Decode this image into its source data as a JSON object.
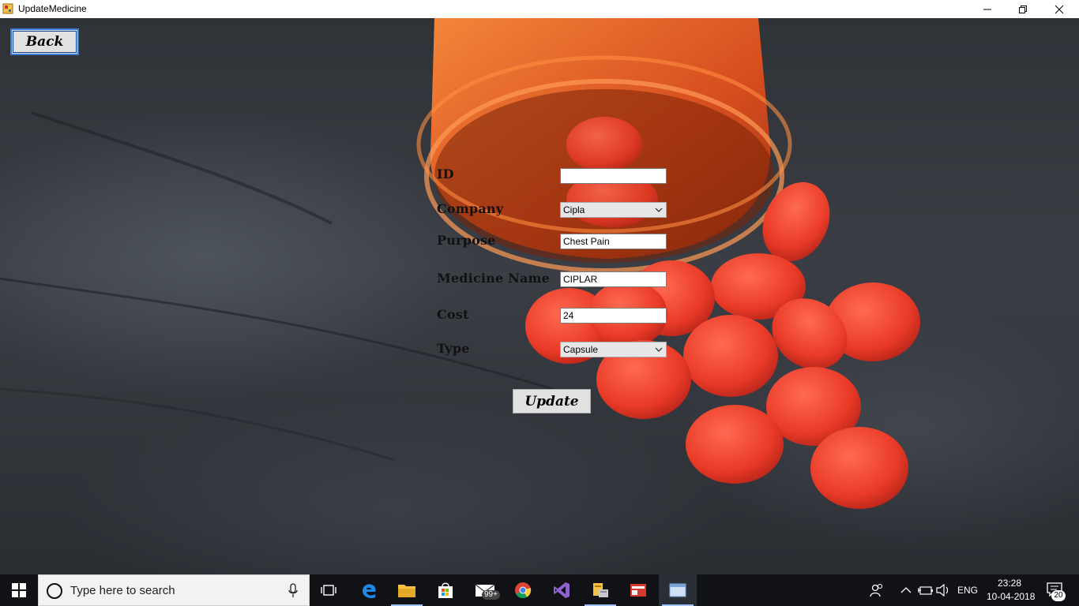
{
  "window": {
    "title": "UpdateMedicine",
    "controls": [
      "minimize-icon",
      "restore-icon",
      "close-icon"
    ]
  },
  "form": {
    "back_label": "Back",
    "update_label": "Update",
    "fields": {
      "id": {
        "label": "ID",
        "value": ""
      },
      "company": {
        "label": "Company",
        "value": "Cipla"
      },
      "purpose": {
        "label": "Purpose",
        "value": "Chest Pain"
      },
      "medicine_name": {
        "label": "Medicine Name",
        "value": "CIPLAR"
      },
      "cost": {
        "label": "Cost",
        "value": "24"
      },
      "type": {
        "label": "Type",
        "value": "Capsule"
      }
    }
  },
  "taskbar": {
    "search_placeholder": "Type here to search",
    "mail_badge": "99+",
    "language": "ENG",
    "time": "23:28",
    "date": "10-04-2018",
    "notification_count": "20",
    "apps": [
      "task-view-icon",
      "edge-icon",
      "file-explorer-icon",
      "store-icon",
      "mail-icon",
      "chrome-icon",
      "visual-studio-icon",
      "db-tool-icon",
      "app-icon-red",
      "window-icon"
    ]
  },
  "colors": {
    "pill": "#f0442f",
    "bottle": "#f05a1e",
    "background": "#3a3e44",
    "taskbar": "#101216"
  }
}
